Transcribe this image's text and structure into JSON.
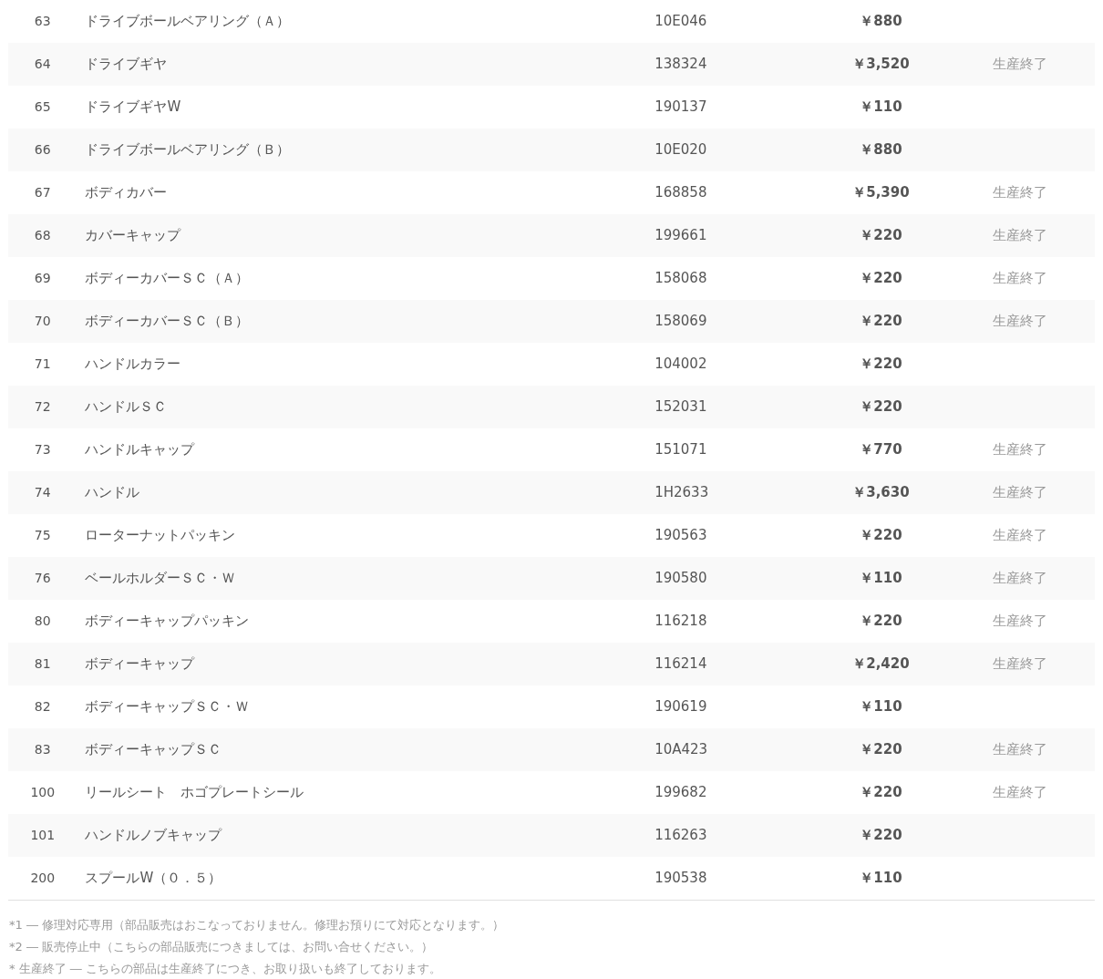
{
  "rows": [
    {
      "no": "63",
      "name": "ドライブボールベアリング（Ａ）",
      "code": "10E046",
      "price": "￥880"
    },
    {
      "no": "64",
      "name": "ドライブギヤ",
      "code": "138324",
      "price": "￥3,520",
      "status": "生産終了"
    },
    {
      "no": "65",
      "name": "ドライブギヤW",
      "code": "190137",
      "price": "￥110"
    },
    {
      "no": "66",
      "name": "ドライブボールベアリング（Ｂ）",
      "code": "10E020",
      "price": "￥880"
    },
    {
      "no": "67",
      "name": "ボディカバー",
      "code": "168858",
      "price": "￥5,390",
      "status": "生産終了"
    },
    {
      "no": "68",
      "name": "カバーキャップ",
      "code": "199661",
      "price": "￥220",
      "status": "生産終了"
    },
    {
      "no": "69",
      "name": "ボディーカバーＳＣ（Ａ）",
      "code": "158068",
      "price": "￥220",
      "status": "生産終了"
    },
    {
      "no": "70",
      "name": "ボディーカバーＳＣ（Ｂ）",
      "code": "158069",
      "price": "￥220",
      "status": "生産終了"
    },
    {
      "no": "71",
      "name": "ハンドルカラー",
      "code": "104002",
      "price": "￥220"
    },
    {
      "no": "72",
      "name": "ハンドルＳＣ",
      "code": "152031",
      "price": "￥220"
    },
    {
      "no": "73",
      "name": "ハンドルキャップ",
      "code": "151071",
      "price": "￥770",
      "status": "生産終了"
    },
    {
      "no": "74",
      "name": "ハンドル",
      "code": "1H2633",
      "price": "￥3,630",
      "status": "生産終了"
    },
    {
      "no": "75",
      "name": "ローターナットパッキン",
      "code": "190563",
      "price": "￥220",
      "status": "生産終了"
    },
    {
      "no": "76",
      "name": "ベールホルダーＳＣ・Ｗ",
      "code": "190580",
      "price": "￥110",
      "status": "生産終了"
    },
    {
      "no": "80",
      "name": "ボディーキャップパッキン",
      "code": "116218",
      "price": "￥220",
      "status": "生産終了"
    },
    {
      "no": "81",
      "name": "ボディーキャップ",
      "code": "116214",
      "price": "￥2,420",
      "status": "生産終了"
    },
    {
      "no": "82",
      "name": "ボディーキャップＳＣ・Ｗ",
      "code": "190619",
      "price": "￥110"
    },
    {
      "no": "83",
      "name": "ボディーキャップＳＣ",
      "code": "10A423",
      "price": "￥220",
      "status": "生産終了"
    },
    {
      "no": "100",
      "name": "リールシート　ホゴプレートシール",
      "code": "199682",
      "price": "￥220",
      "status": "生産終了"
    },
    {
      "no": "101",
      "name": "ハンドルノブキャップ",
      "code": "116263",
      "price": "￥220"
    },
    {
      "no": "200",
      "name": "スプールW（０．５）",
      "code": "190538",
      "price": "￥110"
    }
  ],
  "footnotes": [
    "*1 ― 修理対応専用（部品販売はおこなっておりません。修理お預りにて対応となります。）",
    "*2 ― 販売停止中（こちらの部品販売につきましては、お問い合せください。）",
    "* 生産終了 ― こちらの部品は生産終了につき、お取り扱いも終了しております。"
  ]
}
